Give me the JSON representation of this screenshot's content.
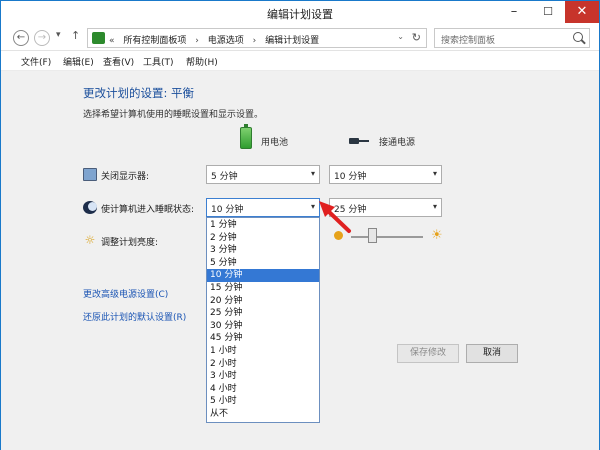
{
  "window": {
    "title": "编辑计划设置",
    "minimize_glyph": "–",
    "maximize_glyph": "☐",
    "close_glyph": "✕"
  },
  "nav": {
    "back_glyph": "←",
    "forward_glyph": "→",
    "recent_glyph": "▾",
    "up_glyph": "↑",
    "prefix": "«",
    "breadcrumbs": [
      "所有控制面板项",
      "电源选项",
      "编辑计划设置"
    ],
    "breadcrumb_sep": "›",
    "dropdown_glyph": "⌄",
    "refresh_glyph": "↻",
    "search_placeholder": "搜索控制面板"
  },
  "menu": [
    "文件(F)",
    "编辑(E)",
    "查看(V)",
    "工具(T)",
    "帮助(H)"
  ],
  "main": {
    "heading": "更改计划的设置: 平衡",
    "subheading": "选择希望计算机使用的睡眠设置和显示设置。",
    "col_battery": "用电池",
    "col_plugged": "接通电源",
    "rows": [
      {
        "label": "关闭显示器:",
        "battery": "5 分钟",
        "plugged": "10 分钟"
      },
      {
        "label": "使计算机进入睡眠状态:",
        "battery": "10 分钟",
        "plugged": "25 分钟"
      },
      {
        "label": "调整计划亮度:"
      }
    ],
    "brightness": {
      "battery_icon_side": "left",
      "plugged_level": 0.3
    },
    "links": [
      "更改高级电源设置(C)",
      "还原此计划的默认设置(R)"
    ],
    "save_label": "保存修改",
    "cancel_label": "取消",
    "dropdown_glyph": "▾"
  },
  "sleep_dropdown": {
    "selected": "10 分钟",
    "options": [
      "1 分钟",
      "2 分钟",
      "3 分钟",
      "5 分钟",
      "10 分钟",
      "15 分钟",
      "20 分钟",
      "25 分钟",
      "30 分钟",
      "45 分钟",
      "1 小时",
      "2 小时",
      "3 小时",
      "4 小时",
      "5 小时",
      "从不"
    ]
  },
  "colors": {
    "heading": "#1b4f9c",
    "link": "#1b55b4",
    "selection": "#3478d4",
    "close_button": "#c7342b",
    "annotation_arrow": "#e02020"
  }
}
